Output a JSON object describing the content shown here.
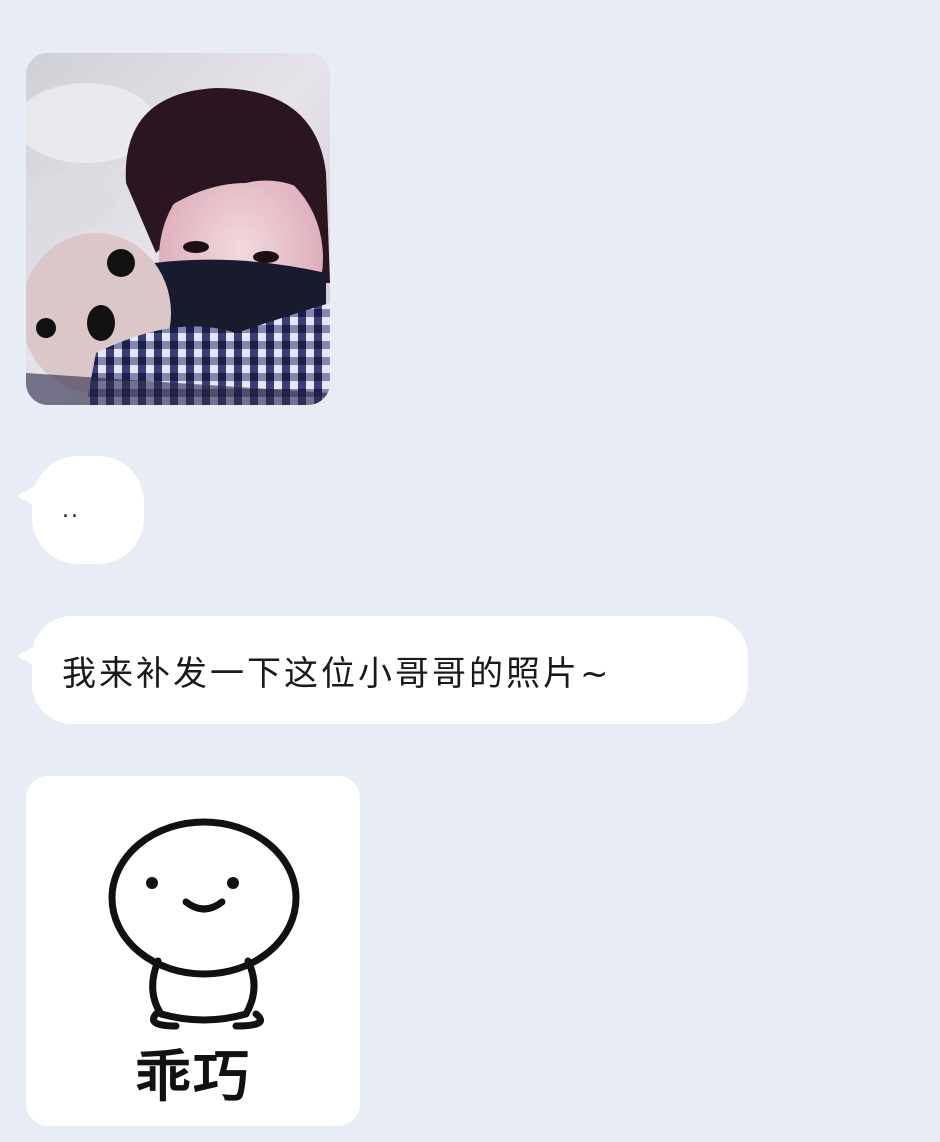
{
  "messages": [
    {
      "type": "image",
      "description_icon": "photo-selfie-icon"
    },
    {
      "type": "text",
      "text": ".."
    },
    {
      "type": "text",
      "text": "我来补发一下这位小哥哥的照片~"
    },
    {
      "type": "sticker",
      "caption": "乖巧",
      "icon": "cute-blob-sticker-icon"
    }
  ],
  "colors": {
    "background": "#e8ecf4",
    "bubble": "#ffffff",
    "text": "#1a1a1a"
  }
}
